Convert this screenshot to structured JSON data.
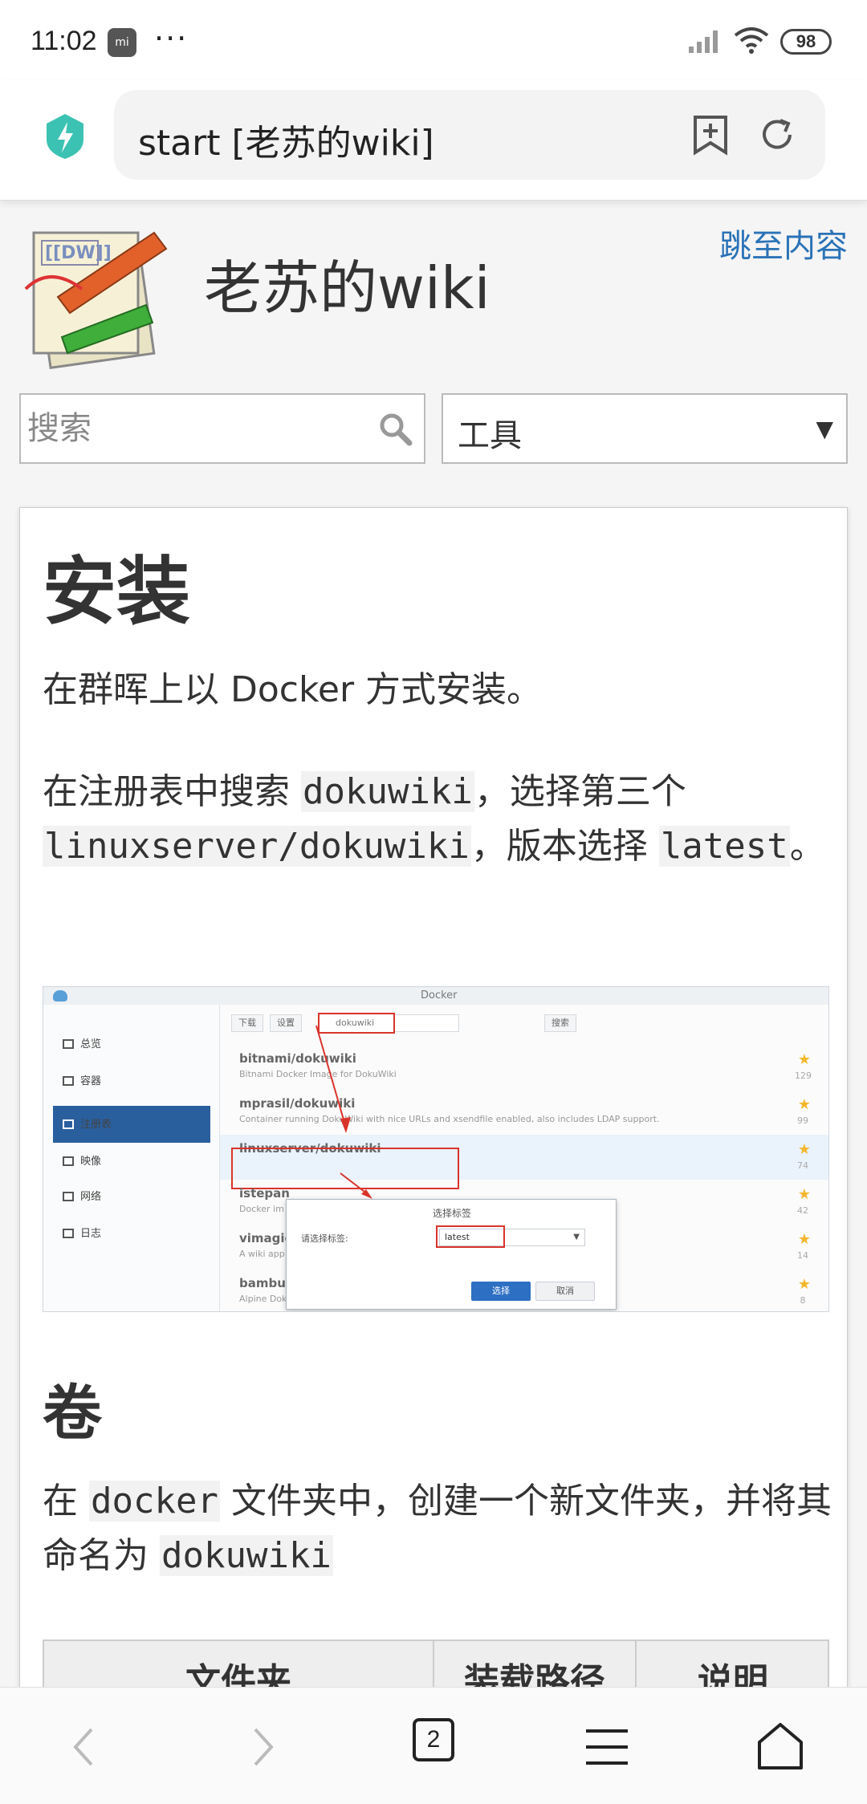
{
  "status_bar": {
    "time": "11:02",
    "notification_dots": "···",
    "battery": "98",
    "mi_label": "mi"
  },
  "browser": {
    "url_title": "start [老苏的wiki]",
    "tab_count": "2"
  },
  "site": {
    "logo_text": "[[DW]]",
    "title": "老苏的wiki",
    "skip_link": "跳至内容",
    "search_placeholder": "搜索",
    "tools_label": "工具",
    "tools_arrow": "▼"
  },
  "article": {
    "heading_install": "安装",
    "para_install": "在群晖上以 Docker 方式安装。",
    "para_registry": {
      "t1": "在注册表中搜索 ",
      "code1": "dokuwiki",
      "t2": "，选择第三个 ",
      "code2": "linuxserver/dokuwiki",
      "t3": "，版本选择 ",
      "code3": "latest",
      "t4": "。"
    },
    "heading_volume": "卷",
    "para_volume": {
      "t1": "在 ",
      "code1": "docker",
      "t2": " 文件夹中，创建一个新文件夹，并将其命名为 ",
      "code2": "dokuwiki"
    },
    "table_headers": [
      "文件夹",
      "装载路径",
      "说明"
    ]
  },
  "screenshot": {
    "window_title": "Docker",
    "sidebar": [
      "总览",
      "容器",
      "注册表",
      "映像",
      "网络",
      "日志"
    ],
    "toolbar": {
      "download": "下载",
      "settings": "设置",
      "search_value": "dokuwiki",
      "search_btn": "搜索"
    },
    "results": [
      {
        "name": "bitnami/dokuwiki",
        "desc": "Bitnami Docker Image for DokuWiki",
        "stars": "129"
      },
      {
        "name": "mprasil/dokuwiki",
        "desc": "Container running DokuWiki with nice URLs and xsendfile enabled, also includes LDAP support.",
        "stars": "99"
      },
      {
        "name": "linuxserver/dokuwiki",
        "desc": "",
        "stars": "74"
      },
      {
        "name": "istepan",
        "desc": "Docker im",
        "stars": "42"
      },
      {
        "name": "vimagic",
        "desc": "A wiki app",
        "stars": "14"
      },
      {
        "name": "bambu",
        "desc": "Alpine DokuWiki Docker Container",
        "stars": "8"
      }
    ],
    "dialog": {
      "title": "选择标签",
      "label": "请选择标签:",
      "value": "latest",
      "ok": "选择",
      "cancel": "取消"
    }
  },
  "colors": {
    "link": "#2b73b7",
    "accent_red": "#d9342b",
    "active_nav": "#2a5f9e"
  }
}
